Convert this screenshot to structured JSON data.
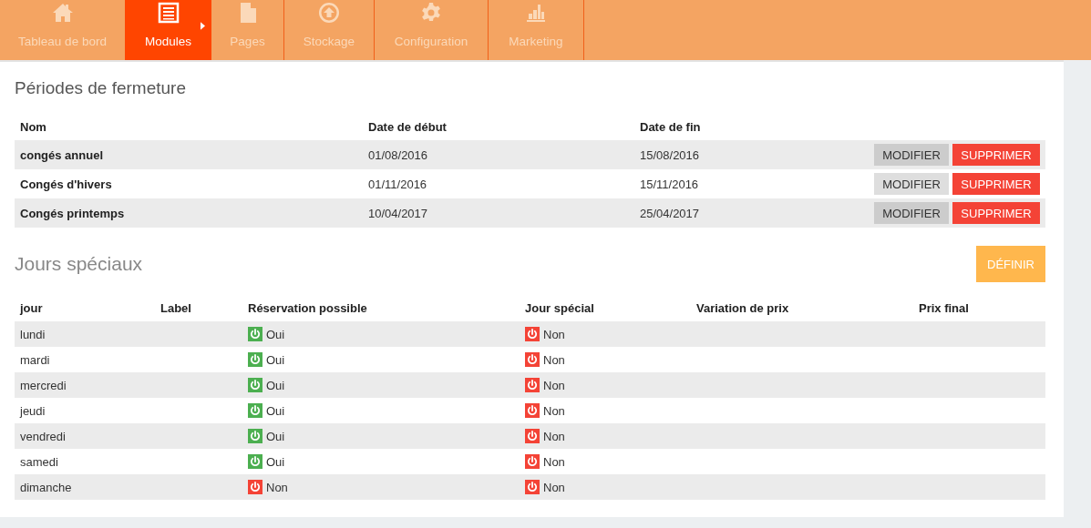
{
  "nav": [
    {
      "label": "Tableau de bord",
      "kind": "home",
      "selected": false
    },
    {
      "label": "Modules",
      "kind": "list",
      "selected": true
    },
    {
      "label": "Pages",
      "kind": "page",
      "selected": false
    },
    {
      "label": "Stockage",
      "kind": "upload",
      "selected": false
    },
    {
      "label": "Configuration",
      "kind": "gear",
      "selected": false
    },
    {
      "label": "Marketing",
      "kind": "chart",
      "selected": false
    }
  ],
  "closures": {
    "title": "Périodes de fermeture",
    "columns": [
      "Nom",
      "Date de début",
      "Date de fin"
    ],
    "rows": [
      {
        "name": "congés annuel",
        "start": "01/08/2016",
        "end": "15/08/2016",
        "modify": "MODIFIER",
        "delete": "SUPPRIMER"
      },
      {
        "name": "Congés d'hivers",
        "start": "01/11/2016",
        "end": "15/11/2016",
        "modify": "MODIFIER",
        "delete": "SUPPRIMER"
      },
      {
        "name": "Congés printemps",
        "start": "10/04/2017",
        "end": "25/04/2017",
        "modify": "MODIFIER",
        "delete": "SUPPRIMER"
      }
    ]
  },
  "special_days": {
    "title": "Jours spéciaux",
    "define_button": "DÉFINIR",
    "columns": [
      "jour",
      "Label",
      "Réservation possible",
      "Jour spécial",
      "Variation de prix",
      "Prix final"
    ],
    "rows": [
      {
        "day": "lundi",
        "reservation": {
          "on": true,
          "text": "Oui"
        },
        "special": {
          "on": false,
          "text": "Non"
        }
      },
      {
        "day": "mardi",
        "reservation": {
          "on": true,
          "text": "Oui"
        },
        "special": {
          "on": false,
          "text": "Non"
        }
      },
      {
        "day": "mercredi",
        "reservation": {
          "on": true,
          "text": "Oui"
        },
        "special": {
          "on": false,
          "text": "Non"
        }
      },
      {
        "day": "jeudi",
        "reservation": {
          "on": true,
          "text": "Oui"
        },
        "special": {
          "on": false,
          "text": "Non"
        }
      },
      {
        "day": "vendredi",
        "reservation": {
          "on": true,
          "text": "Oui"
        },
        "special": {
          "on": false,
          "text": "Non"
        }
      },
      {
        "day": "samedi",
        "reservation": {
          "on": true,
          "text": "Oui"
        },
        "special": {
          "on": false,
          "text": "Non"
        }
      },
      {
        "day": "dimanche",
        "reservation": {
          "on": false,
          "text": "Non"
        },
        "special": {
          "on": false,
          "text": "Non"
        }
      }
    ]
  }
}
